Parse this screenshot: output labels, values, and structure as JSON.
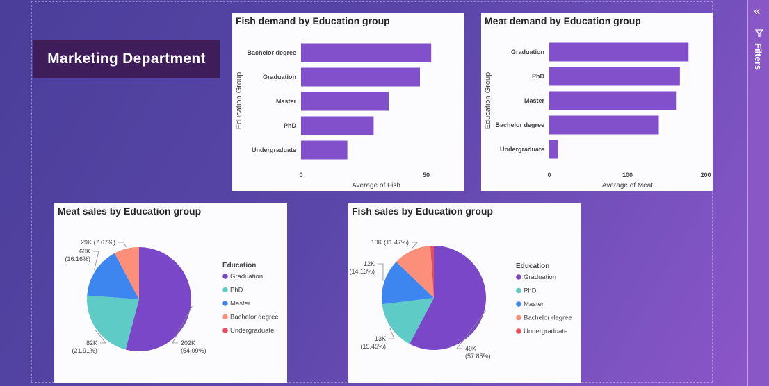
{
  "header": {
    "title": "Marketing Department"
  },
  "filters_pane": {
    "label": "Filters",
    "collapse_icon": "double-chevron-left-icon",
    "filter_icon": "funnel-icon"
  },
  "colors": {
    "bar": "#8250cb",
    "Graduation": "#7b47c9",
    "PhD": "#5ecbc7",
    "Master": "#3d86f0",
    "Bachelor degree": "#fb8f79",
    "Undergraduate": "#e64e5a"
  },
  "chart_data": [
    {
      "type": "bar",
      "orientation": "horizontal",
      "title": "Fish demand by Education group",
      "xlabel": "Average of Fish",
      "ylabel": "Education Group",
      "categories": [
        "Bachelor degree",
        "Graduation",
        "Master",
        "PhD",
        "Undergraduate"
      ],
      "values": [
        52,
        47.5,
        35,
        29,
        18.5
      ],
      "xlim": [
        0,
        60
      ],
      "xticks": [
        "0",
        "50"
      ],
      "xtick_values": [
        0,
        50
      ]
    },
    {
      "type": "bar",
      "orientation": "horizontal",
      "title": "Meat demand by Education group",
      "xlabel": "Average of Meat",
      "ylabel": "Education Group",
      "categories": [
        "Graduation",
        "PhD",
        "Master",
        "Bachelor degree",
        "Undergraduate"
      ],
      "values": [
        178,
        167,
        162,
        140,
        11
      ],
      "xlim": [
        0,
        200
      ],
      "xticks": [
        "0",
        "100",
        "200"
      ],
      "xtick_values": [
        0,
        100,
        200
      ]
    },
    {
      "type": "pie",
      "title": "Meat sales by Education group",
      "legend_title": "Education",
      "legend_position": "right",
      "categories": [
        "Graduation",
        "PhD",
        "Master",
        "Bachelor degree",
        "Undergraduate"
      ],
      "values": [
        202,
        82,
        60,
        29,
        0
      ],
      "percents": [
        54.09,
        21.91,
        16.16,
        7.67,
        0.17
      ],
      "data_labels": [
        {
          "category": "Graduation",
          "value": "202K",
          "percent": "(54.09%)"
        },
        {
          "category": "PhD",
          "value": "82K",
          "percent": "(21.91%)"
        },
        {
          "category": "Master",
          "value": "60K",
          "percent": "(16.16%)"
        },
        {
          "category": "Bachelor degree",
          "value": "29K (7.67%)",
          "percent": ""
        }
      ]
    },
    {
      "type": "pie",
      "title": "Fish sales by Education group",
      "legend_title": "Education",
      "legend_position": "right",
      "categories": [
        "Graduation",
        "PhD",
        "Master",
        "Bachelor degree",
        "Undergraduate"
      ],
      "values": [
        49,
        13,
        12,
        10,
        0.9
      ],
      "percents": [
        57.85,
        15.45,
        14.13,
        11.47,
        1.1
      ],
      "data_labels": [
        {
          "category": "Graduation",
          "value": "49K",
          "percent": "(57.85%)"
        },
        {
          "category": "PhD",
          "value": "13K",
          "percent": "(15.45%)"
        },
        {
          "category": "Master",
          "value": "12K",
          "percent": "(14.13%)"
        },
        {
          "category": "Bachelor degree",
          "value": "10K (11.47%)",
          "percent": ""
        }
      ]
    }
  ]
}
